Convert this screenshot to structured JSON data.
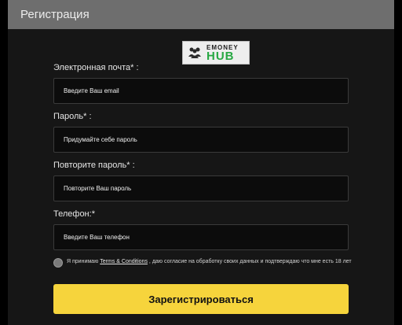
{
  "header": {
    "title": "Регистрация"
  },
  "logo": {
    "top": "EMONEY",
    "bottom": "HUB",
    "icon": "people-group-icon"
  },
  "form": {
    "email_label": "Электронная почта* :",
    "email_placeholder": "Введите Ваш email",
    "password_label": "Пароль* :",
    "password_placeholder": "Придумайте себе пароль",
    "repeat_label": "Повторите пароль* :",
    "repeat_placeholder": "Повторите Ваш пароль",
    "phone_label": "Телефон:*",
    "phone_placeholder": "Введите Ваш телефон",
    "consent_prefix": "Я принимаю ",
    "consent_link": "Terms & Conditions",
    "consent_suffix": " , даю согласие на обработку своих данных и подтверждаю что мне есть 18 лет",
    "submit_label": "Зарегистрироваться"
  },
  "colors": {
    "header_bg": "#6e6e6e",
    "panel_bg": "#161616",
    "accent": "#f6d43c",
    "logo_green": "#27a843"
  }
}
